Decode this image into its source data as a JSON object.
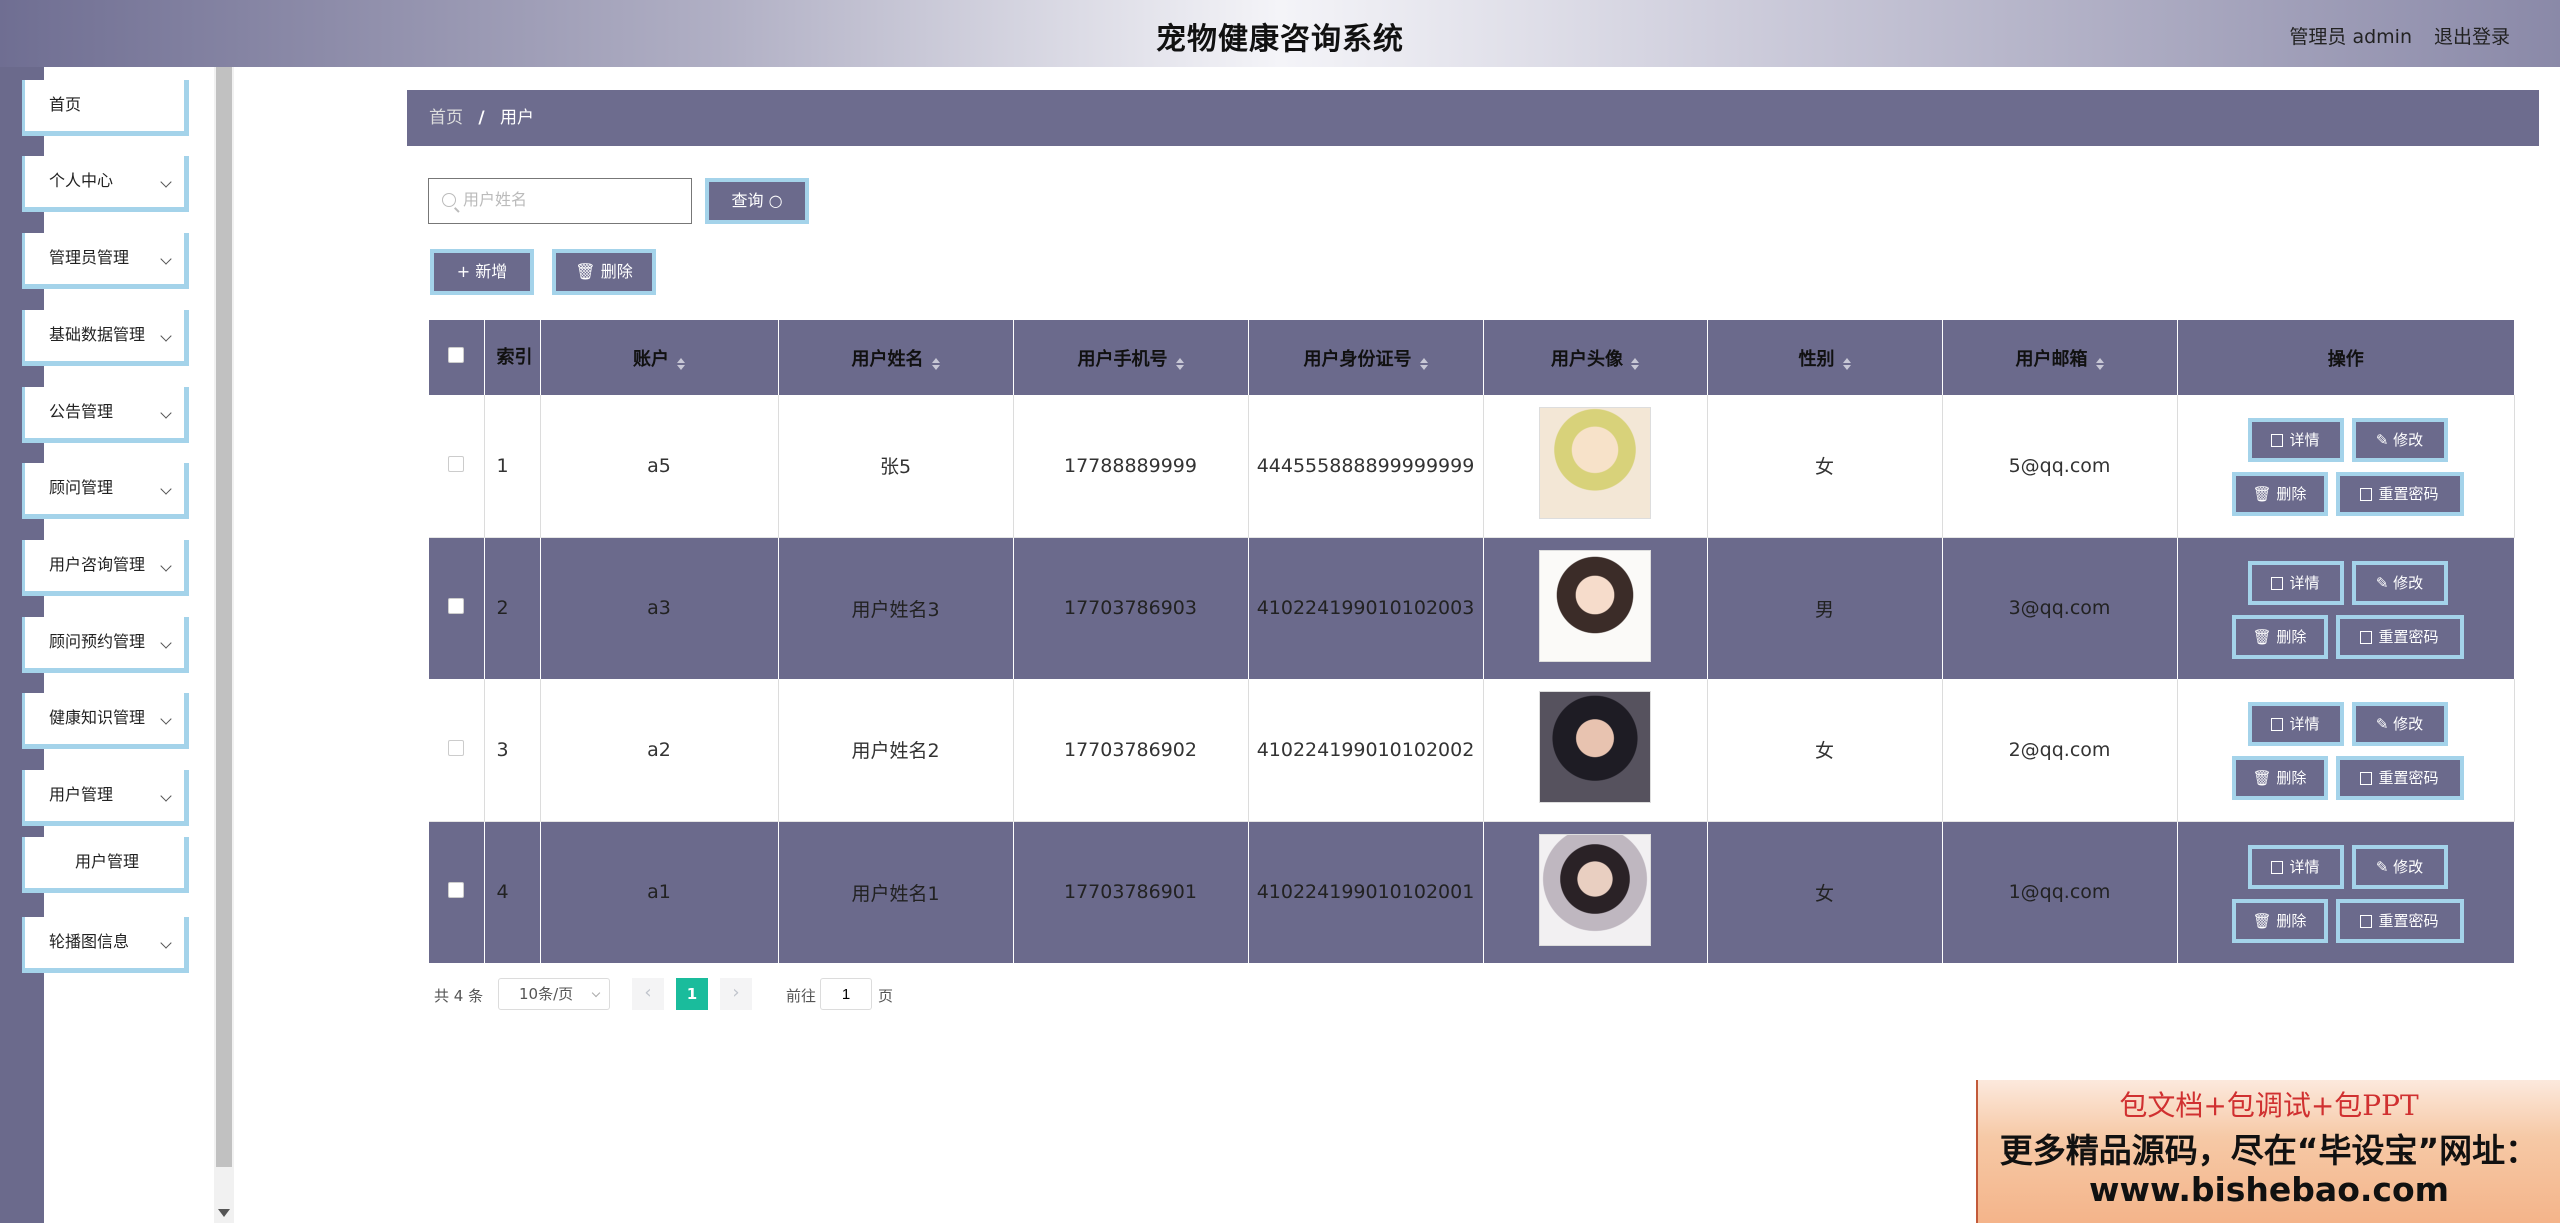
{
  "header": {
    "title": "宠物健康咨询系统",
    "user": "管理员 admin",
    "logout": "退出登录"
  },
  "sidebar": {
    "items": [
      {
        "label": "首页"
      },
      {
        "label": "个人中心"
      },
      {
        "label": "管理员管理"
      },
      {
        "label": "基础数据管理"
      },
      {
        "label": "公告管理"
      },
      {
        "label": "顾问管理"
      },
      {
        "label": "用户咨询管理"
      },
      {
        "label": "顾问预约管理"
      },
      {
        "label": "健康知识管理"
      },
      {
        "label": "用户管理"
      },
      {
        "label": "用户管理"
      },
      {
        "label": "轮播图信息"
      }
    ]
  },
  "breadcrumb": {
    "home": "首页",
    "separator": "/",
    "current": "用户"
  },
  "search": {
    "placeholder": "用户姓名",
    "button": "查询"
  },
  "actions": {
    "add": "+ 新增",
    "delete": "删除"
  },
  "table": {
    "headers": {
      "index": "索引",
      "account": "账户",
      "name": "用户姓名",
      "phone": "用户手机号",
      "idcard": "用户身份证号",
      "avatar": "用户头像",
      "gender": "性别",
      "email": "用户邮箱",
      "ops": "操作"
    },
    "op_labels": {
      "detail": "详情",
      "edit": "修改",
      "delete": "删除",
      "reset": "重置密码"
    },
    "rows": [
      {
        "index": "1",
        "account": "a5",
        "name": "张5",
        "phone": "17788889999",
        "idcard": "444555888899999999",
        "gender": "女",
        "email": "5@qq.com"
      },
      {
        "index": "2",
        "account": "a3",
        "name": "用户姓名3",
        "phone": "17703786903",
        "idcard": "410224199010102003",
        "gender": "男",
        "email": "3@qq.com"
      },
      {
        "index": "3",
        "account": "a2",
        "name": "用户姓名2",
        "phone": "17703786902",
        "idcard": "410224199010102002",
        "gender": "女",
        "email": "2@qq.com"
      },
      {
        "index": "4",
        "account": "a1",
        "name": "用户姓名1",
        "phone": "17703786901",
        "idcard": "410224199010102001",
        "gender": "女",
        "email": "1@qq.com"
      }
    ]
  },
  "pagination": {
    "total": "共 4 条",
    "page_size": "10条/页",
    "current": "1",
    "goto_prefix": "前往",
    "goto_value": "1",
    "goto_suffix": "页"
  },
  "promo": {
    "line1": "包文档+包调试+包PPT",
    "line2": "更多精品源码，尽在“毕设宝”网址：",
    "line3": "www.bishebao.com"
  },
  "colors": {
    "primary": "#6b6a8c",
    "accent_border": "#a4d3ea",
    "pager_active": "#1abc9c"
  }
}
